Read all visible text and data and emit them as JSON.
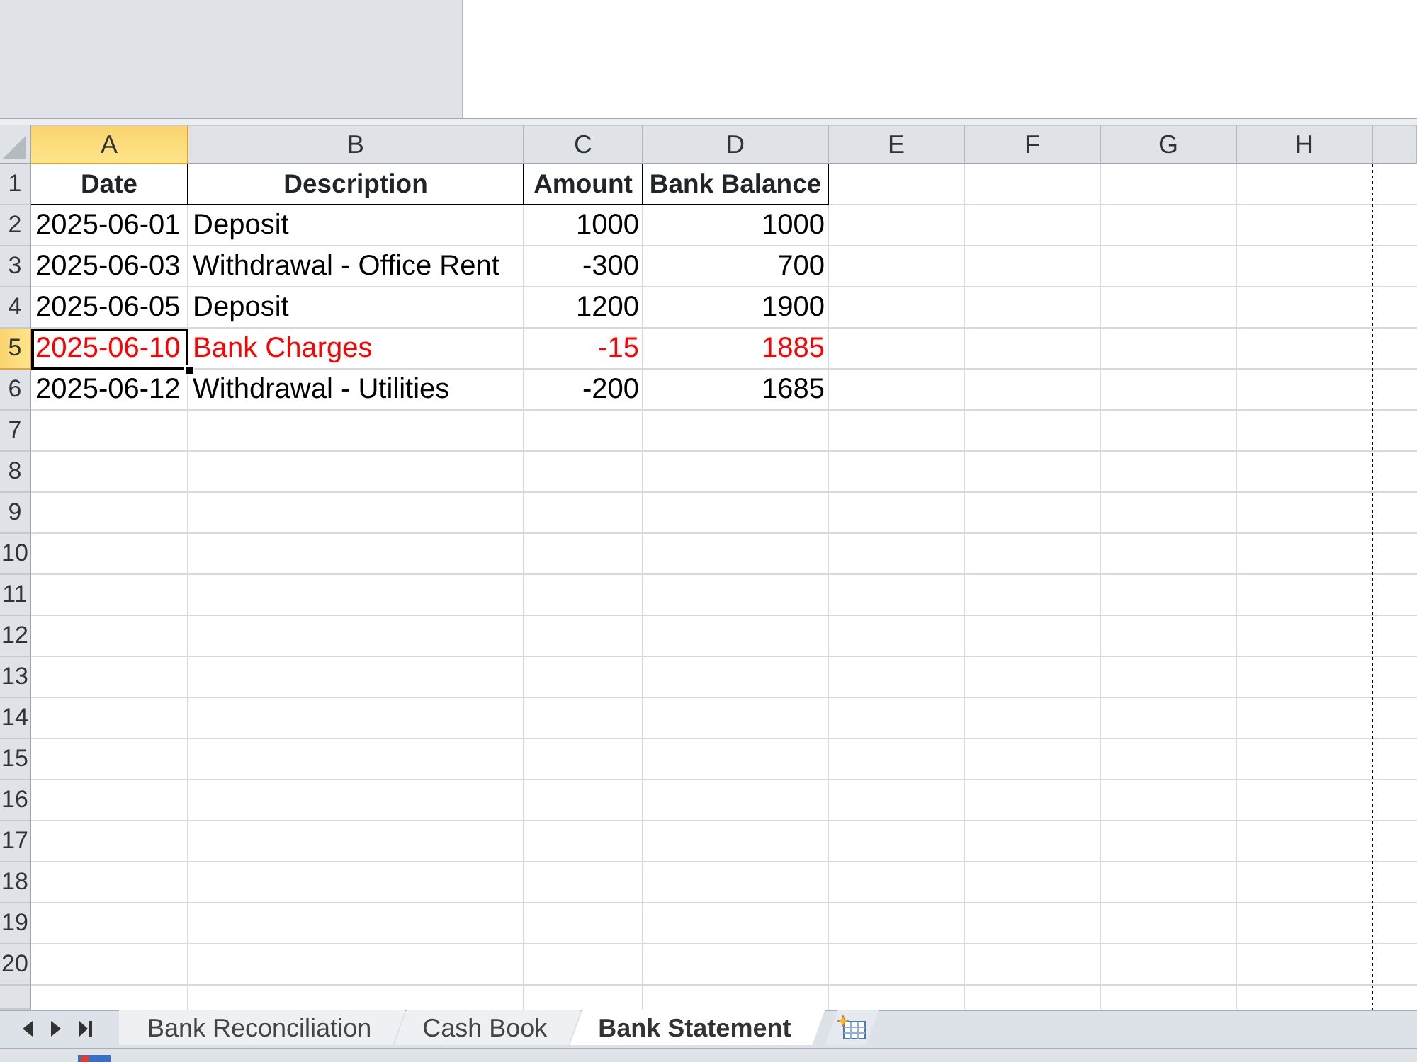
{
  "columns": [
    {
      "label": "A",
      "selected": true
    },
    {
      "label": "B",
      "selected": false
    },
    {
      "label": "C",
      "selected": false
    },
    {
      "label": "D",
      "selected": false
    },
    {
      "label": "E",
      "selected": false
    },
    {
      "label": "F",
      "selected": false
    },
    {
      "label": "G",
      "selected": false
    },
    {
      "label": "H",
      "selected": false
    }
  ],
  "rows": [
    {
      "label": "1",
      "selected": false
    },
    {
      "label": "2",
      "selected": false
    },
    {
      "label": "3",
      "selected": false
    },
    {
      "label": "4",
      "selected": false
    },
    {
      "label": "5",
      "selected": true
    },
    {
      "label": "6",
      "selected": false
    },
    {
      "label": "7",
      "selected": false
    },
    {
      "label": "8",
      "selected": false
    },
    {
      "label": "9",
      "selected": false
    },
    {
      "label": "10",
      "selected": false
    },
    {
      "label": "11",
      "selected": false
    },
    {
      "label": "12",
      "selected": false
    },
    {
      "label": "13",
      "selected": false
    },
    {
      "label": "14",
      "selected": false
    },
    {
      "label": "15",
      "selected": false
    },
    {
      "label": "16",
      "selected": false
    },
    {
      "label": "17",
      "selected": false
    },
    {
      "label": "18",
      "selected": false
    },
    {
      "label": "19",
      "selected": false
    },
    {
      "label": "20",
      "selected": false
    }
  ],
  "table": {
    "columns": [
      {
        "heading": "Date",
        "kind": "text"
      },
      {
        "heading": "Description",
        "kind": "text"
      },
      {
        "heading": "Amount",
        "kind": "number"
      },
      {
        "heading": "Bank Balance",
        "kind": "number"
      }
    ],
    "rows": [
      {
        "cells": [
          "2025-06-01",
          "Deposit",
          "1000",
          "1000"
        ],
        "color": "#000000"
      },
      {
        "cells": [
          "2025-06-03",
          "Withdrawal - Office Rent",
          "-300",
          "700"
        ],
        "color": "#000000"
      },
      {
        "cells": [
          "2025-06-05",
          "Deposit",
          "1200",
          "1900"
        ],
        "color": "#000000"
      },
      {
        "cells": [
          "2025-06-10",
          "Bank Charges",
          "-15",
          "1885"
        ],
        "color": "#ff0000"
      },
      {
        "cells": [
          "2025-06-12",
          "Withdrawal - Utilities",
          "-200",
          "1685"
        ],
        "color": "#000000"
      }
    ]
  },
  "sheet_tabs": [
    {
      "label": "Bank Reconciliation",
      "selected": false
    },
    {
      "label": "Cash Book",
      "selected": false
    },
    {
      "label": "Bank Statement",
      "selected": true
    }
  ]
}
